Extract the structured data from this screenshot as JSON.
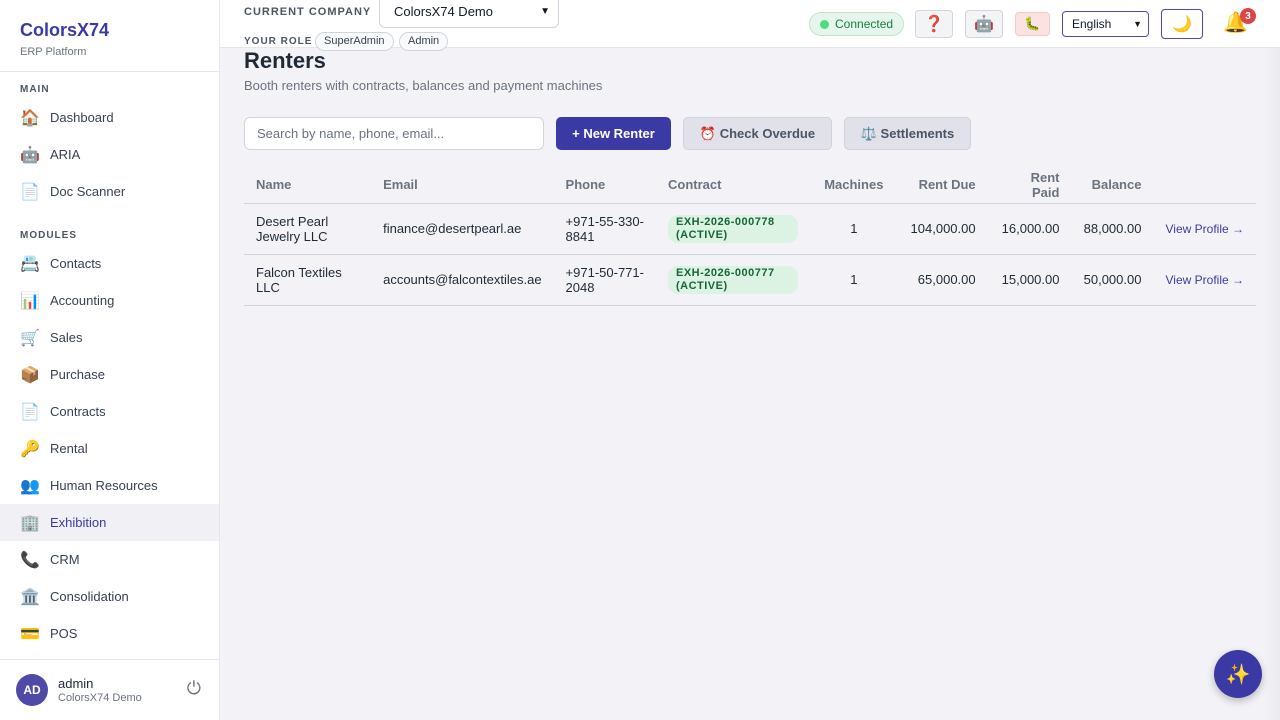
{
  "brand": {
    "title": "ColorsX74",
    "subtitle": "ERP Platform"
  },
  "sidebar": {
    "main_label": "MAIN",
    "main_items": [
      {
        "icon": "🏠",
        "icon_name": "home-icon",
        "label": "Dashboard"
      },
      {
        "icon": "🤖",
        "icon_name": "robot-icon",
        "label": "ARIA"
      },
      {
        "icon": "📄",
        "icon_name": "document-icon",
        "label": "Doc Scanner"
      }
    ],
    "modules_label": "MODULES",
    "module_items": [
      {
        "icon": "📇",
        "icon_name": "contact-card-icon",
        "label": "Contacts"
      },
      {
        "icon": "📊",
        "icon_name": "bar-chart-icon",
        "label": "Accounting"
      },
      {
        "icon": "🛒",
        "icon_name": "cart-icon",
        "label": "Sales"
      },
      {
        "icon": "📦",
        "icon_name": "package-icon",
        "label": "Purchase"
      },
      {
        "icon": "📄",
        "icon_name": "document-icon",
        "label": "Contracts"
      },
      {
        "icon": "🔑",
        "icon_name": "key-icon",
        "label": "Rental"
      },
      {
        "icon": "👥",
        "icon_name": "people-icon",
        "label": "Human Resources"
      },
      {
        "icon": "🏢",
        "icon_name": "building-icon",
        "label": "Exhibition",
        "active": true
      },
      {
        "icon": "📞",
        "icon_name": "phone-icon",
        "label": "CRM"
      },
      {
        "icon": "🏛️",
        "icon_name": "bank-icon",
        "label": "Consolidation"
      },
      {
        "icon": "💳",
        "icon_name": "credit-card-icon",
        "label": "POS"
      }
    ],
    "user": {
      "initials": "AD",
      "name": "admin",
      "company": "ColorsX74 Demo",
      "logout_icon": "⏻"
    }
  },
  "header": {
    "company_label": "CURRENT COMPANY",
    "company_value": "ColorsX74 Demo",
    "role_label": "YOUR ROLE",
    "roles": [
      "SuperAdmin",
      "Admin"
    ],
    "status": "Connected",
    "help_icon": "❓",
    "bot_icon": "🤖",
    "bug_icon": "🐛",
    "language": "English",
    "theme_icon": "🌙",
    "bell_icon": "🔔",
    "notification_count": "3"
  },
  "page": {
    "title": "Renters",
    "subtitle": "Booth renters with contracts, balances and payment machines",
    "search_placeholder": "Search by name, phone, email...",
    "new_button": "+ New Renter",
    "overdue_button": "⏰ Check Overdue",
    "settlements_button": "⚖️ Settlements"
  },
  "table": {
    "columns": [
      "Name",
      "Email",
      "Phone",
      "Contract",
      "Machines",
      "Rent Due",
      "Rent Paid",
      "Balance",
      ""
    ],
    "rows": [
      {
        "name": "Desert Pearl Jewelry LLC",
        "email": "finance@desertpearl.ae",
        "phone": "+971-55-330-8841",
        "contract": "EXH-2026-000778 (ACTIVE)",
        "machines": "1",
        "rent_due": "104,000.00",
        "rent_paid": "16,000.00",
        "balance": "88,000.00",
        "action": "View Profile →"
      },
      {
        "name": "Falcon Textiles LLC",
        "email": "accounts@falcontextiles.ae",
        "phone": "+971-50-771-2048",
        "contract": "EXH-2026-000777 (ACTIVE)",
        "machines": "1",
        "rent_due": "65,000.00",
        "rent_paid": "15,000.00",
        "balance": "50,000.00",
        "action": "View Profile →"
      }
    ]
  },
  "fab_icon": "✨"
}
